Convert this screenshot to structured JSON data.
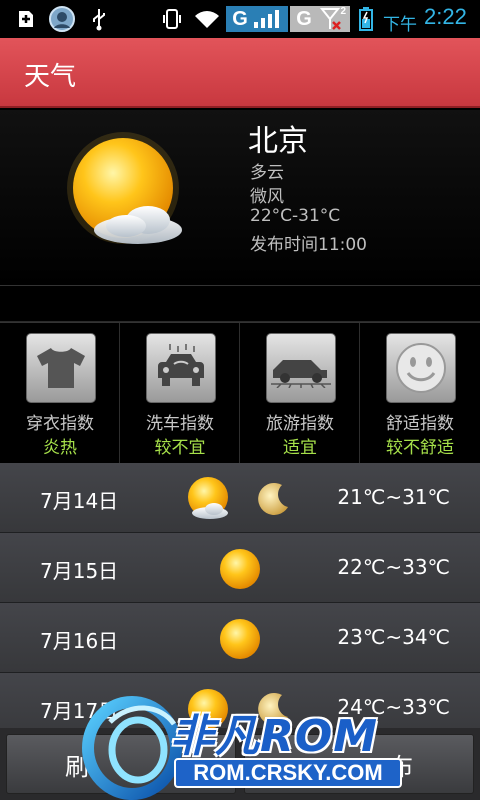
{
  "status_bar": {
    "icons": [
      "notification-add-icon",
      "app-avatar-icon",
      "usb-icon",
      "vibrate-icon",
      "wifi-icon",
      "signal-icon",
      "no-signal-icon",
      "battery-icon"
    ],
    "network_letter_1": "G",
    "network_letter_2": "G",
    "sim_number": "2",
    "time_prefix": "下午",
    "time": "2:22",
    "accent": "#33b5e5"
  },
  "header": {
    "title": "天气",
    "color": "#d84a50"
  },
  "current": {
    "city": "北京",
    "condition": "多云",
    "wind": "微风",
    "temp_range": "22°C-31°C",
    "publish_time": "发布时间11:00",
    "icon": "sun-cloud-icon"
  },
  "indices": [
    {
      "label": "穿衣指数",
      "value": "炎热",
      "icon": "tshirt-icon"
    },
    {
      "label": "洗车指数",
      "value": "较不宜",
      "icon": "car-wash-icon"
    },
    {
      "label": "旅游指数",
      "value": "适宜",
      "icon": "car-travel-icon"
    },
    {
      "label": "舒适指数",
      "value": "较不舒适",
      "icon": "smiley-icon"
    }
  ],
  "forecast": [
    {
      "date": "7月14日",
      "temp": "21℃~31℃",
      "day_icon": "sun-cloud-icon",
      "night_icon": "moon-icon"
    },
    {
      "date": "7月15日",
      "temp": "22℃~33℃",
      "day_icon": "sun-icon"
    },
    {
      "date": "7月16日",
      "temp": "23℃~34℃",
      "day_icon": "sun-icon"
    },
    {
      "date": "7月17日",
      "temp": "24℃~33℃",
      "day_icon": "sun-icon",
      "night_icon": "moon-icon"
    }
  ],
  "bottom_buttons": {
    "left_label": "刷",
    "right_label": "布"
  },
  "watermark": {
    "brand": "非凡ROM",
    "url": "ROM.CRSKY.COM"
  }
}
